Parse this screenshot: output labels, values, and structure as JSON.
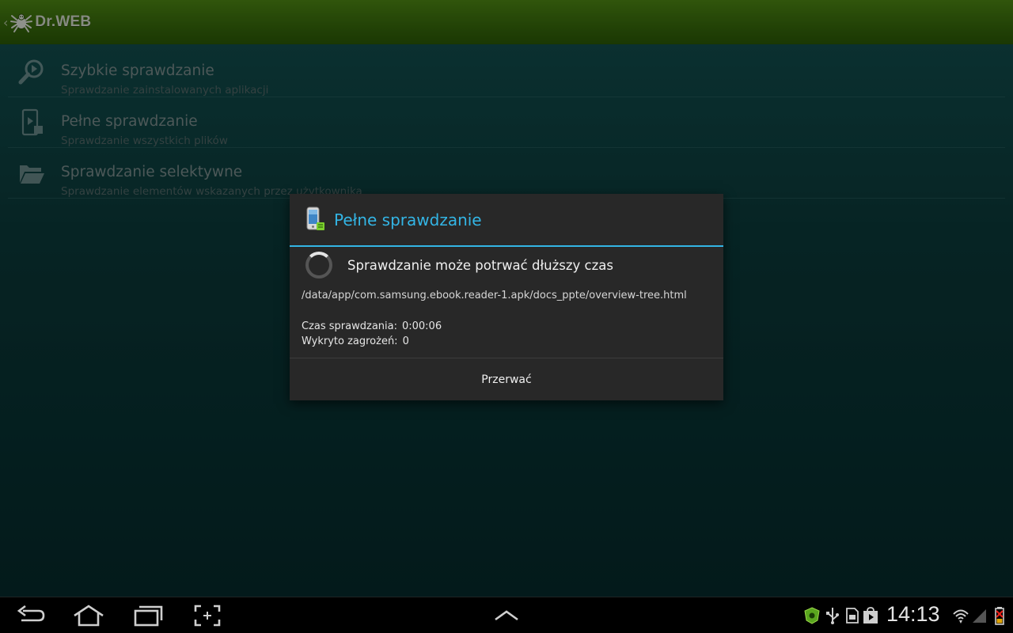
{
  "app": {
    "title": "Dr.WEB"
  },
  "menu": [
    {
      "title": "Szybkie sprawdzanie",
      "subtitle": "Sprawdzanie zainstalowanych aplikacji",
      "icon": "magnifier-play-icon"
    },
    {
      "title": "Pełne sprawdzanie",
      "subtitle": "Sprawdzanie wszystkich plików",
      "icon": "device-scan-icon"
    },
    {
      "title": "Sprawdzanie selektywne",
      "subtitle": "Sprawdzanie elementów wskazanych przez użytkownika",
      "icon": "folder-open-icon"
    }
  ],
  "dialog": {
    "title": "Pełne sprawdzanie",
    "message": "Sprawdzanie może potrwać dłuższy czas",
    "path": "/data/app/com.samsung.ebook.reader-1.apk/docs_ppte/overview-tree.html",
    "stats": [
      {
        "label": "Czas sprawdzania:",
        "value": "0:00:06"
      },
      {
        "label": "Wykryto zagrożeń:",
        "value": "0"
      }
    ],
    "button": "Przerwać"
  },
  "system": {
    "clock": "14:13",
    "nav": [
      "back-icon",
      "home-icon",
      "recent-apps-icon",
      "screenshot-icon",
      "chevron-up-icon"
    ],
    "tray": [
      "drweb-shield-icon",
      "usb-icon",
      "sd-card-icon",
      "play-store-icon",
      "wifi-icon",
      "signal-icon",
      "battery-charging-icon"
    ]
  },
  "colors": {
    "actionbar": "#3a6e0c",
    "accent": "#33b5e5",
    "background": "#0b3a3a",
    "dialog": "#282828"
  }
}
